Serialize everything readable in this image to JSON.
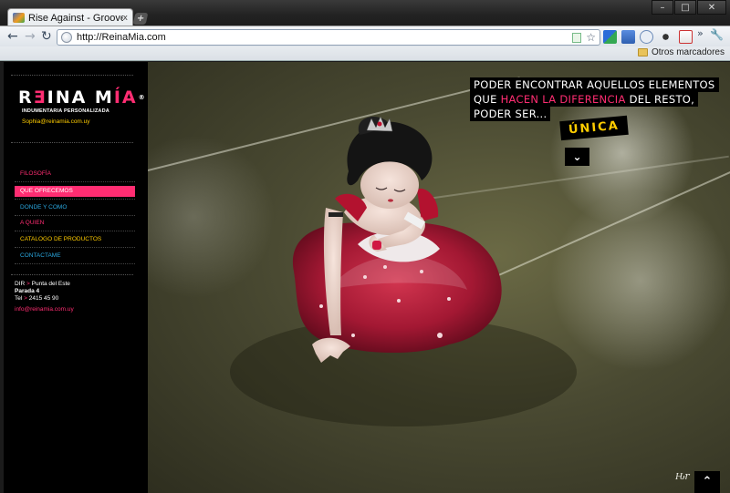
{
  "browser": {
    "tab_title": "Rise Against - Grooveshark",
    "tab_close": "x",
    "new_tab": "+",
    "url": "http://ReinaMia.com",
    "back": "←",
    "forward": "→",
    "reload": "↻",
    "star": "☆",
    "window_controls": {
      "minimize": "–",
      "maximize": "□",
      "close": "✕"
    },
    "extensions_more": "»",
    "wrench": "🔧",
    "bookmarks_folder": "Otros marcadores"
  },
  "site": {
    "sidebar_toggle": "›",
    "logo": {
      "part1": "R",
      "pink": "Ǝ",
      "part2": "INA M",
      "part3": "ÍA",
      "reg": "®"
    },
    "tagline": "INDUMENTARIA PERSONALIZADA",
    "contact_email": "Sophia@reinamia.com.uy",
    "menu": [
      {
        "label": "FILOSOFÍA",
        "color": "#ff2d72",
        "active": false
      },
      {
        "label": "QUE OFRECEMOS",
        "color": "#ffffff",
        "active": true
      },
      {
        "label": "DONDE Y COMO",
        "color": "#2aa8e0",
        "active": false
      },
      {
        "label": "A QUIEN",
        "color": "#ff2d72",
        "active": false
      },
      {
        "label": "CATALOGO DE PRODUCTOS",
        "color": "#ffcc00",
        "active": false
      },
      {
        "label": "CONTACTAME",
        "color": "#2aa8e0",
        "active": false
      }
    ],
    "address": {
      "dir_label": "DIR",
      "dir_value": "Punta del Este",
      "line2": "Parada 4",
      "tel_label": "Tel",
      "tel_value": "2415 45 90",
      "separator": ">"
    },
    "info_email": "info@reinamia.com.uy",
    "headline": {
      "line1": "PODER ENCONTRAR AQUELLOS ELEMENTOS",
      "line2_pre": "QUE",
      "line2_accent": "HACEN LA DIFERENCIA",
      "line2_post": "DEL RESTO,",
      "line3": "PODER SER...",
      "highlight": "ÚNICA"
    },
    "down_arrow": "⌄",
    "up_arrow": "⌃",
    "signature": "Ԋr"
  },
  "colors": {
    "accent_pink": "#ff2d72",
    "accent_yellow": "#ffcc00",
    "accent_blue": "#2aa8e0"
  }
}
